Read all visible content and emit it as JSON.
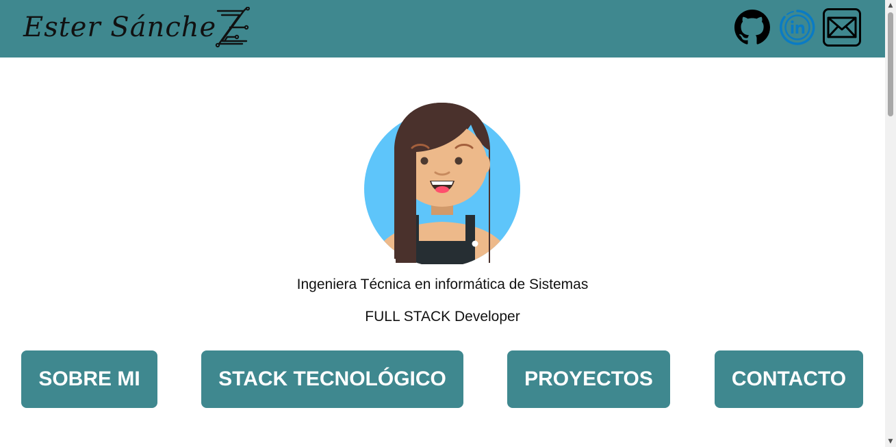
{
  "header": {
    "brand_name": "Ester Sánche",
    "brand_logo_letter_icon": "circuit-z-icon",
    "background_color": "#3f888f",
    "social": [
      {
        "name": "github",
        "icon": "github-icon"
      },
      {
        "name": "linkedin",
        "icon": "linkedin-icon",
        "color": "#0a7bc4"
      },
      {
        "name": "email",
        "icon": "mail-icon"
      }
    ]
  },
  "profile": {
    "avatar_icon": "avatar-illustration",
    "role": "Ingeniera Técnica en informática de Sistemas",
    "title": "FULL STACK Developer"
  },
  "nav": {
    "button_color": "#3f888f",
    "items": [
      {
        "label": "SOBRE MI"
      },
      {
        "label": "STACK TECNOLÓGICO"
      },
      {
        "label": "PROYECTOS"
      },
      {
        "label": "CONTACTO"
      }
    ]
  },
  "scrollbar": {
    "up_arrow": "▲",
    "down_arrow": "▼"
  }
}
